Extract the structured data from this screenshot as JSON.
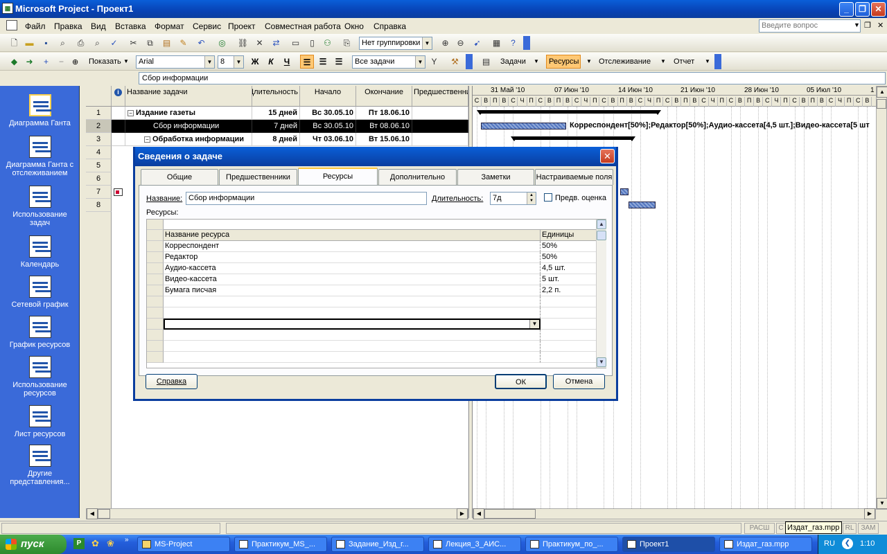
{
  "window": {
    "title": "Microsoft Project - Проект1",
    "app_icon": "project-icon"
  },
  "menu": {
    "items": [
      "Файл",
      "Правка",
      "Вид",
      "Вставка",
      "Формат",
      "Сервис",
      "Проект",
      "Совместная работа",
      "Окно",
      "Справка"
    ],
    "ask_placeholder": "Введите вопрос"
  },
  "toolbar1": {
    "grouping": "Нет группировки"
  },
  "toolbar2": {
    "show_label": "Показать",
    "font": "Arial",
    "size": "8",
    "bold": "Ж",
    "italic": "К",
    "underline": "Ч",
    "filter": "Все задачи",
    "tasks_btn": "Задачи",
    "resources_btn": "Ресурсы",
    "tracking_btn": "Отслеживание",
    "report_btn": "Отчет"
  },
  "entry_bar": {
    "value": "Сбор информации"
  },
  "view_bar": {
    "items": [
      "Диаграмма Ганта",
      "Диаграмма Ганта с отслеживанием",
      "Использование задач",
      "Календарь",
      "Сетевой график",
      "График ресурсов",
      "Использование ресурсов",
      "Лист ресурсов",
      "Другие представления..."
    ]
  },
  "grid": {
    "info_icon": "info-icon",
    "columns": [
      "Название задачи",
      "Длительность",
      "Начало",
      "Окончание",
      "Предшественники"
    ],
    "rows": [
      {
        "id": "1",
        "name": "Издание газеты",
        "duration": "15 дней",
        "start": "Вс 30.05.10",
        "finish": "Пт 18.06.10",
        "pred": ""
      },
      {
        "id": "2",
        "name": "Сбор информации",
        "duration": "7 дней",
        "start": "Вс 30.05.10",
        "finish": "Вт 08.06.10",
        "pred": ""
      },
      {
        "id": "3",
        "name": "Обработка информации",
        "duration": "8 дней",
        "start": "Чт 03.06.10",
        "finish": "Вт 15.06.10",
        "pred": ""
      },
      {
        "id": "4"
      },
      {
        "id": "5"
      },
      {
        "id": "6"
      },
      {
        "id": "7"
      },
      {
        "id": "8"
      }
    ]
  },
  "gantt": {
    "weeks": [
      "31 Май '10",
      "07 Июн '10",
      "14 Июн '10",
      "21 Июн '10",
      "28 Июн '10",
      "05 Июл '10",
      "1"
    ],
    "days": [
      "С",
      "В",
      "П",
      "В",
      "С",
      "Ч",
      "П",
      "С",
      "В",
      "П",
      "В",
      "С",
      "Ч",
      "П",
      "С",
      "В",
      "П",
      "В",
      "С",
      "Ч",
      "П",
      "С",
      "В",
      "П",
      "В",
      "С",
      "Ч",
      "П",
      "С",
      "В",
      "П",
      "В",
      "С",
      "Ч",
      "П",
      "С",
      "В",
      "П",
      "В",
      "С",
      "Ч",
      "П",
      "С",
      "В"
    ],
    "bar_label": "Корреспондент[50%];Редактор[50%];Аудио-кассета[4,5 шт.];Видео-кассета[5 шт"
  },
  "dialog": {
    "title": "Сведения о задаче",
    "tabs": [
      "Общие",
      "Предшественники",
      "Ресурсы",
      "Дополнительно",
      "Заметки",
      "Настраиваемые поля"
    ],
    "active_tab": "Ресурсы",
    "name_label": "Название:",
    "name_value": "Сбор информации",
    "duration_label": "Длительность:",
    "duration_value": "7д",
    "estimate_label": "Предв. оценка",
    "resources_label": "Ресурсы:",
    "res_columns": [
      "Название ресурса",
      "Единицы"
    ],
    "res_rows": [
      {
        "name": "Корреспондент",
        "units": "50%"
      },
      {
        "name": "Редактор",
        "units": "50%"
      },
      {
        "name": "Аудио-кассета",
        "units": "4,5 шт."
      },
      {
        "name": "Видео-кассета",
        "units": "5 шт."
      },
      {
        "name": "Бумага писчая",
        "units": "2,2 п."
      }
    ],
    "help_btn": "Справка",
    "ok_btn": "ОК",
    "cancel_btn": "Отмена"
  },
  "status": {
    "ext": "РАСШ",
    "caps": "С",
    "num": "RL",
    "scrl": "ЗАМ",
    "tooltip": "Издат_газ.mpp"
  },
  "taskbar": {
    "start": "пуск",
    "tasks": [
      "MS-Project",
      "Практикум_MS_...",
      "Задание_Изд_г...",
      "Лекция_3_АИС...",
      "Практикум_по_...",
      "Проект1",
      "Издат_газ.mpp"
    ],
    "lang": "RU",
    "clock": "1:10"
  }
}
